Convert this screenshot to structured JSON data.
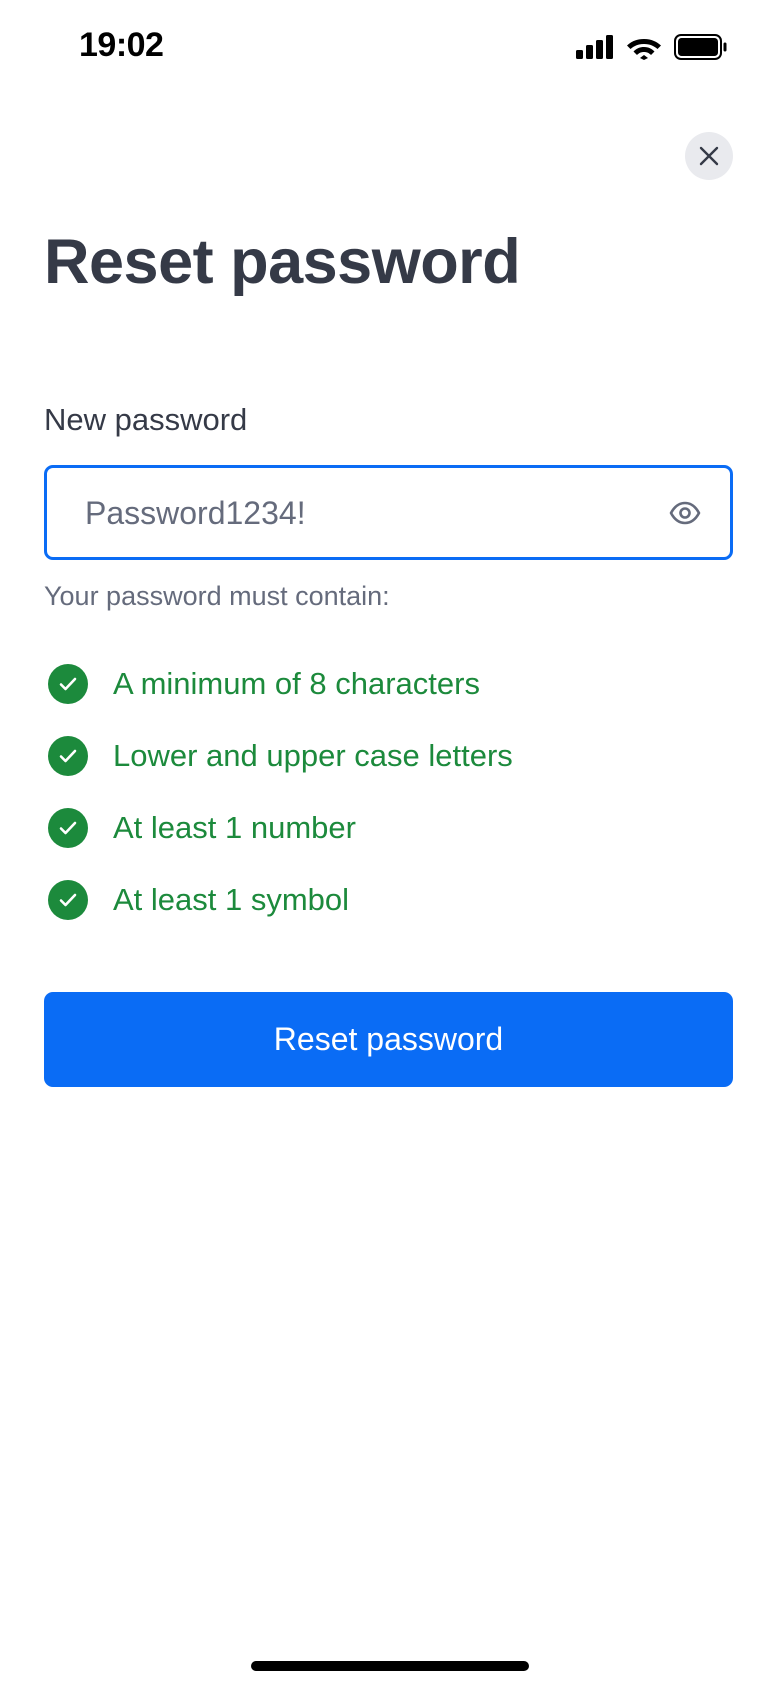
{
  "status_bar": {
    "time": "19:02",
    "icons": [
      "cellular-signal-icon",
      "wifi-icon",
      "battery-icon"
    ]
  },
  "close_icon": "close-icon",
  "page": {
    "title": "Reset password"
  },
  "form": {
    "label": "New password",
    "password_value": "Password1234!",
    "toggle_icon": "eye-icon",
    "hint": "Your password must contain:"
  },
  "requirements": [
    {
      "label": "A minimum of 8 characters",
      "met": true
    },
    {
      "label": "Lower and upper case letters",
      "met": true
    },
    {
      "label": "At least 1 number",
      "met": true
    },
    {
      "label": "At least 1 symbol",
      "met": true
    }
  ],
  "submit_label": "Reset password",
  "colors": {
    "accent": "#0a6cf5",
    "success": "#1c8a3c",
    "title_text": "#353a47",
    "muted_text": "#656b7c"
  }
}
